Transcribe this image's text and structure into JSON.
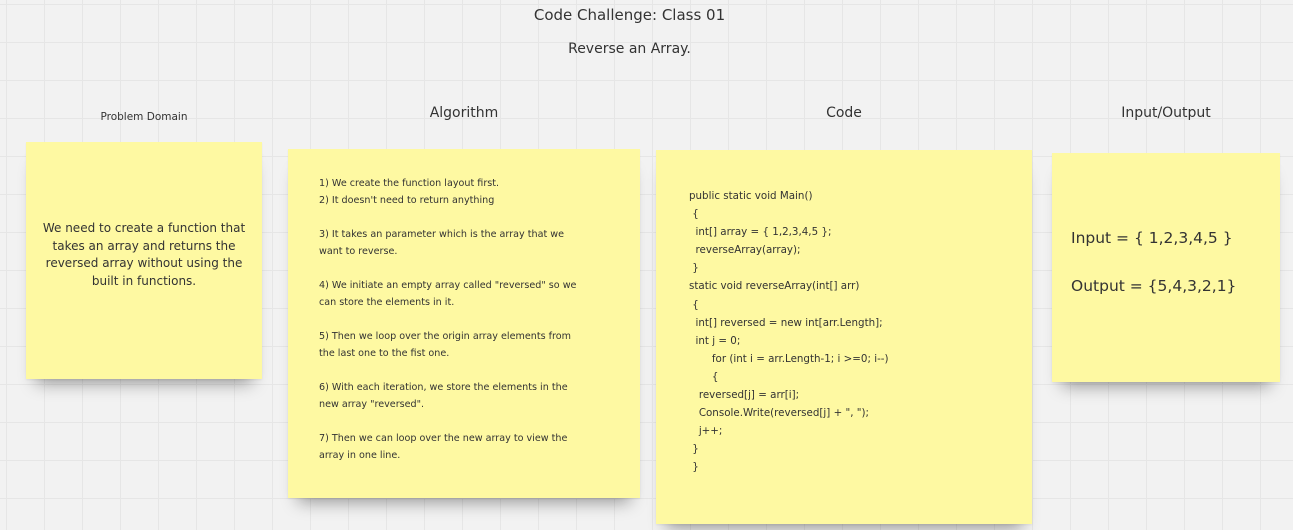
{
  "board": {
    "title": "Code Challenge: Class 01",
    "subtitle": "Reverse an Array."
  },
  "columns": {
    "problem_domain": "Problem Domain",
    "algorithm": "Algorithm",
    "code": "Code",
    "input_output": "Input/Output"
  },
  "problem_note": {
    "text": "We need to create a function that takes an array and returns the reversed array without using the built in functions."
  },
  "algorithm_note": {
    "lines": [
      "1) We create the function layout first.",
      "2) It doesn't need to return anything",
      "",
      "3) It takes an parameter which is the array that we",
      "want to reverse.",
      "",
      "4) We initiate an empty array called \"reversed\" so we",
      "can store the elements in it.",
      "",
      "5) Then we loop over the origin array elements from",
      "the last one to the fist one.",
      "",
      "6)  With each iteration, we store the elements in the",
      "new array \"reversed\".",
      "",
      "7)  Then we can loop over the new array to view the",
      "array in one line."
    ]
  },
  "code_note": {
    "lines": [
      "public static void Main()",
      " {",
      "  int[] array = { 1,2,3,4,5 };",
      "  reverseArray(array);",
      " }",
      "static void reverseArray(int[] arr)",
      " {",
      "  int[] reversed = new int[arr.Length];",
      "  int j = 0;",
      "       for (int i = arr.Length-1; i >=0; i--)",
      "       {",
      "   reversed[j] = arr[i];",
      "   Console.Write(reversed[j] + \", \");",
      "   j++;",
      " }",
      " }"
    ]
  },
  "io_note": {
    "input": "Input = { 1,2,3,4,5 }",
    "output": "Output = {5,4,3,2,1}"
  }
}
